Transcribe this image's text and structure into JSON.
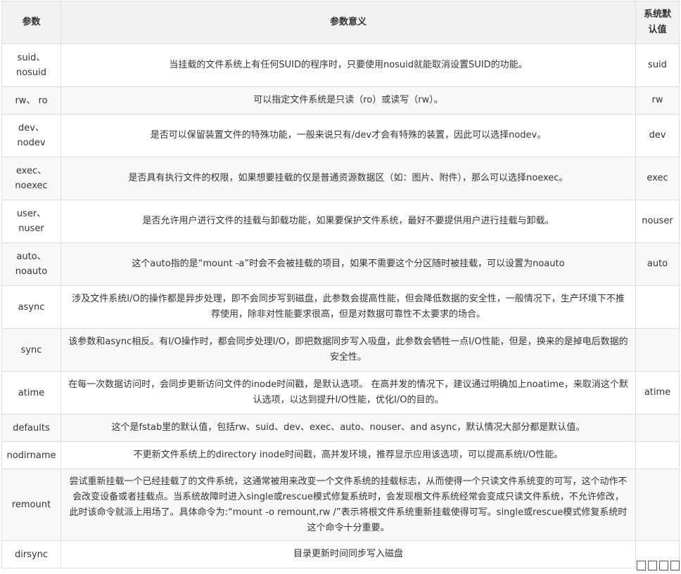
{
  "table": {
    "headers": {
      "param": "参数",
      "meaning": "参数意义",
      "default_line1": "系统默",
      "default_line2": "认值"
    },
    "rows": [
      {
        "name": [
          "suid、",
          "nosuid"
        ],
        "meaning": "当挂载的文件系统上有任何SUID的程序时，只要使用nosuid就能取消设置SUID的功能。",
        "default": "suid"
      },
      {
        "name": [
          "rw、 ro"
        ],
        "meaning": "可以指定文件系统是只读（ro）或读写（rw）。",
        "default": "rw"
      },
      {
        "name": [
          "dev、",
          "nodev"
        ],
        "meaning": "是否可以保留装置文件的特殊功能，一般来说只有/dev才会有特殊的装置，因此可以选择nodev。",
        "default": "dev"
      },
      {
        "name": [
          "exec、",
          "noexec"
        ],
        "meaning": "是否具有执行文件的权限，如果想要挂载的仅是普通资源数据区（如：图片、附件），那么可以选择noexec。",
        "default": "exec"
      },
      {
        "name": [
          "user、",
          "nuser"
        ],
        "meaning": "是否允许用户进行文件的挂载与卸载功能，如果要保护文件系统，最好不要提供用户进行挂载与卸载。",
        "default": "nouser"
      },
      {
        "name": [
          "auto、",
          "noauto"
        ],
        "meaning": "这个auto指的是“mount -a”时会不会被挂载的项目，如果不需要这个分区随时被挂载，可以设置为noauto",
        "default": "auto"
      },
      {
        "name": [
          "async"
        ],
        "meaning": "涉及文件系统I/O的操作都是异步处理，即不会同步写到磁盘，此参数会提高性能，但会降低数据的安全性，一般情况下，生产环境下不推荐使用，除非对性能要求很高，但是对数据可靠性不太要求的场合。",
        "default": ""
      },
      {
        "name": [
          "sync"
        ],
        "meaning": "该参数和async相反。有I/O操作时，都会同步处理I/O，即把数据同步写入吸盘，此参数会牺牲一点I/O性能，但是，换来的是掉电后数据的安全性。",
        "default": ""
      },
      {
        "name": [
          "atime"
        ],
        "meaning": "在每一次数据访问时，会同步更新访问文件的inode时间戳，是默认选项。 在高并发的情况下，建议通过明确加上noatime，来取消这个默认选项，以达到提升I/O性能，优化I/O的目的。",
        "default": "atime"
      },
      {
        "name": [
          "defaults"
        ],
        "meaning": "这个是fstab里的默认值，包括rw、suid、dev、exec、auto、nouser、and async，默认情况大部分都是默认值。",
        "default": ""
      },
      {
        "name": [
          "nodirname"
        ],
        "meaning": "不更新文件系统上的directory inode时间戳，高并发环境，推荐显示应用该选项，可以提高系统I/O性能。",
        "default": ""
      },
      {
        "name": [
          "remount"
        ],
        "meaning": "尝试重新挂载一个已经挂载了的文件系统，这通常被用来改变一个文件系统的挂载标志，从而使得一个只读文件系统变的可写，这个动作不会改变设备或者挂载点。当系统故障时进入single或rescue模式修复系统时，会发现根文件系统经常会变成只读文件系统，不允许修改，此时该命令就派上用场了。具体命令为:“mount -o remount,rw /”表示将根文件系统重新挂载使得可写。single或rescue模式修复系统时这个命令十分重要。",
        "default": ""
      },
      {
        "name": [
          "dirsync"
        ],
        "meaning": "目录更新时间同步写入磁盘",
        "default": ""
      }
    ]
  }
}
